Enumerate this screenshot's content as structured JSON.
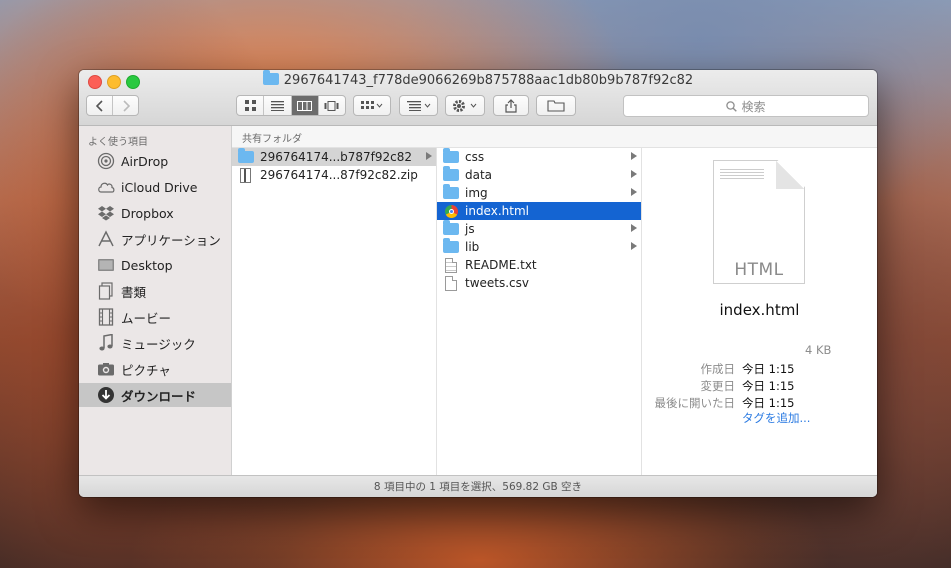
{
  "window": {
    "title": "2967641743_f778de9066269b875788aac1db80b9b787f92c82"
  },
  "toolbar": {
    "back_icon": "chevron-left-icon",
    "forward_icon": "chevron-right-icon",
    "search_placeholder": "検索"
  },
  "sidebar": {
    "header": "よく使う項目",
    "items": [
      {
        "label": "AirDrop",
        "icon": "airdrop-icon"
      },
      {
        "label": "iCloud Drive",
        "icon": "cloud-icon"
      },
      {
        "label": "Dropbox",
        "icon": "dropbox-icon"
      },
      {
        "label": "アプリケーション",
        "icon": "applications-icon"
      },
      {
        "label": "Desktop",
        "icon": "desktop-icon"
      },
      {
        "label": "書類",
        "icon": "documents-icon"
      },
      {
        "label": "ムービー",
        "icon": "movies-icon"
      },
      {
        "label": "ミュージック",
        "icon": "music-icon"
      },
      {
        "label": "ピクチャ",
        "icon": "pictures-icon"
      },
      {
        "label": "ダウンロード",
        "icon": "downloads-icon",
        "selected": true
      }
    ]
  },
  "path_header": "共有フォルダ",
  "column1": [
    {
      "name": "296764174...b787f92c82",
      "type": "folder",
      "selected": true
    },
    {
      "name": "296764174...87f92c82.zip",
      "type": "zip"
    }
  ],
  "column2": [
    {
      "name": "css",
      "type": "folder"
    },
    {
      "name": "data",
      "type": "folder"
    },
    {
      "name": "img",
      "type": "folder"
    },
    {
      "name": "index.html",
      "type": "html",
      "selected": true
    },
    {
      "name": "js",
      "type": "folder"
    },
    {
      "name": "lib",
      "type": "folder"
    },
    {
      "name": "README.txt",
      "type": "text"
    },
    {
      "name": "tweets.csv",
      "type": "file"
    }
  ],
  "preview": {
    "doc_label": "HTML",
    "name": "index.html",
    "size": "4 KB",
    "created_label": "作成日",
    "created": "今日 1:15",
    "modified_label": "変更日",
    "modified": "今日 1:15",
    "opened_label": "最後に開いた日",
    "opened": "今日 1:15",
    "add_tag": "タグを追加..."
  },
  "statusbar": {
    "text": "8 項目中の 1 項目を選択、569.82 GB 空き"
  },
  "colors": {
    "selection_blue": "#1464d2",
    "folder_blue": "#6cb8f0",
    "link_blue": "#2a7ae2"
  }
}
